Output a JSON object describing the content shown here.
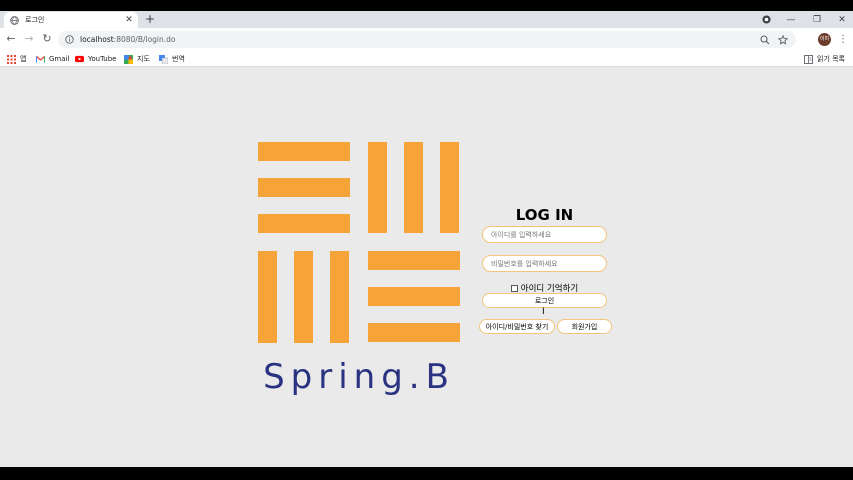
{
  "browser": {
    "tab_title": "로그인",
    "tab_close": "✕",
    "new_tab": "+",
    "url_host": "localhost",
    "url_rest": ":8080/B/login.do",
    "avatar_text": "이미",
    "win_minimize": "—",
    "win_restore": "❐",
    "win_close": "✕"
  },
  "bookmarks": {
    "items": [
      {
        "label": "앱",
        "icon": "apps-grid-icon"
      },
      {
        "label": "Gmail",
        "icon": "gmail-icon"
      },
      {
        "label": "YouTube",
        "icon": "youtube-icon"
      },
      {
        "label": "지도",
        "icon": "maps-icon"
      },
      {
        "label": "번역",
        "icon": "translate-icon"
      }
    ],
    "reading_list": "읽기 목록"
  },
  "page": {
    "brand_text": "Spring.B",
    "login_title": "LOG IN",
    "id_placeholder": "아이디를 입력하세요",
    "pw_placeholder": "비밀번호를 입력하세요",
    "remember_label": "아이디 기억하기",
    "login_button": "로그인",
    "find_button": "아이디/비밀번호 찾기",
    "signup_button": "회원가입",
    "accent_color": "#f6a437",
    "brand_color": "#293381"
  }
}
